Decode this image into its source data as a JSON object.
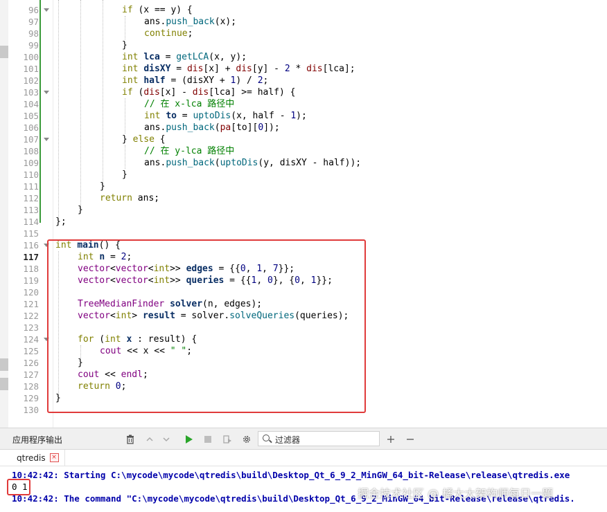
{
  "editor": {
    "line_numbers": [
      "96",
      "97",
      "98",
      "99",
      "100",
      "101",
      "102",
      "103",
      "104",
      "105",
      "106",
      "107",
      "108",
      "109",
      "110",
      "111",
      "112",
      "113",
      "114",
      "115",
      "116",
      "117",
      "118",
      "119",
      "120",
      "121",
      "122",
      "123",
      "124",
      "125",
      "126",
      "127",
      "128",
      "129",
      "130"
    ],
    "current_line": "117"
  },
  "code": {
    "l96": [
      "if",
      " (x == y) {"
    ],
    "l97": [
      "ans.",
      "push_back",
      "(x);"
    ],
    "l98": [
      "continue",
      ";"
    ],
    "l99": [
      "}"
    ],
    "l100": [
      "int",
      " ",
      "lca",
      " = ",
      "getLCA",
      "(x, y);"
    ],
    "l101": [
      "int",
      " ",
      "disXY",
      " = ",
      "dis",
      "[x] + ",
      "dis",
      "[y] - ",
      "2",
      " * ",
      "dis",
      "[lca];"
    ],
    "l102": [
      "int",
      " ",
      "half",
      " = (disXY + ",
      "1",
      ") / ",
      "2",
      ";"
    ],
    "l103": [
      "if",
      " (",
      "dis",
      "[x] - ",
      "dis",
      "[lca] >= half) {"
    ],
    "l104": [
      "// 在 x-lca 路径中"
    ],
    "l105": [
      "int",
      " ",
      "to",
      " = ",
      "uptoDis",
      "(x, half - ",
      "1",
      ");"
    ],
    "l106": [
      "ans.",
      "push_back",
      "(",
      "pa",
      "[to][",
      "0",
      "]);"
    ],
    "l107": [
      "} ",
      "else",
      " {"
    ],
    "l108": [
      "// 在 y-lca 路径中"
    ],
    "l109": [
      "ans.",
      "push_back",
      "(",
      "uptoDis",
      "(y, disXY - half));"
    ],
    "l110": [
      "}"
    ],
    "l111": [
      "}"
    ],
    "l112": [
      "return",
      " ans;"
    ],
    "l113": [
      "}"
    ],
    "l114": [
      "};"
    ],
    "l116": [
      "int",
      " ",
      "main",
      "() {"
    ],
    "l117": [
      "int",
      " ",
      "n",
      " = ",
      "2",
      ";"
    ],
    "l118": [
      "vector",
      "<",
      "vector",
      "<",
      "int",
      ">> ",
      "edges",
      " = {{",
      "0",
      ", ",
      "1",
      ", ",
      "7",
      "}};"
    ],
    "l119": [
      "vector",
      "<",
      "vector",
      "<",
      "int",
      ">> ",
      "queries",
      " = {{",
      "1",
      ", ",
      "0",
      "}, {",
      "0",
      ", ",
      "1",
      "}};"
    ],
    "l121": [
      "TreeMedianFinder",
      " ",
      "solver",
      "(n, edges);"
    ],
    "l122": [
      "vector",
      "<",
      "int",
      "> ",
      "result",
      " = solver.",
      "solveQueries",
      "(queries);"
    ],
    "l124": [
      "for",
      " (",
      "int",
      " ",
      "x",
      " : result) {"
    ],
    "l125": [
      "cout",
      " << x << ",
      "\" \"",
      ";"
    ],
    "l126": [
      "}"
    ],
    "l127": [
      "cout",
      " << ",
      "endl",
      ";"
    ],
    "l128": [
      "return",
      " ",
      "0",
      ";"
    ],
    "l129": [
      "}"
    ]
  },
  "pane": {
    "title": "应用程序输出",
    "filter_placeholder": "过滤器",
    "tab_label": "qtredis",
    "tab_close": "×"
  },
  "output": {
    "line1": "10:42:42: Starting C:\\mycode\\mycode\\qtredis\\build\\Desktop_Qt_6_9_2_MinGW_64_bit-Release\\release\\qtredis.exe",
    "line2": "0 1",
    "line3": "10:42:42: The command \"C:\\mycode\\mycode\\qtredis\\build\\Desktop_Qt_6_9_2_MinGW_64_bit-Release\\release\\qtredis."
  },
  "watermark": "掘金技术社区 @ 橘大大架构师每日一题",
  "colors": {
    "highlight": "#e03a3a",
    "run_green": "#2aa52a",
    "output_blue": "#0000aa"
  }
}
